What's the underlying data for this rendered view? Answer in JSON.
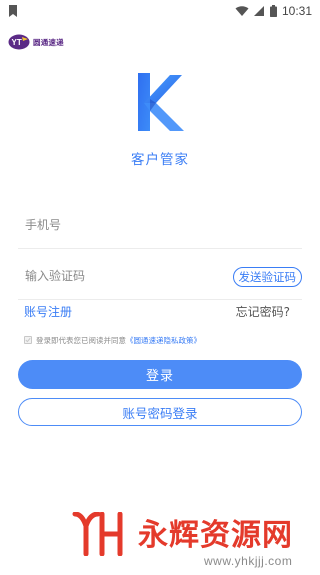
{
  "status_bar": {
    "time": "10:31",
    "icons": [
      "app-notification-icon",
      "wifi-icon",
      "cellular-signal-icon",
      "battery-icon"
    ]
  },
  "brand": {
    "logo_text": "YT",
    "name": "圆通速递"
  },
  "app": {
    "title": "客户管家",
    "logo_letter": "K"
  },
  "form": {
    "phone_placeholder": "手机号",
    "phone_value": "",
    "code_placeholder": "输入验证码",
    "code_value": "",
    "send_code_label": "发送验证码"
  },
  "links": {
    "register": "账号注册",
    "forgot_password": "忘记密码?"
  },
  "agreement": {
    "checked": false,
    "text": "登录即代表您已阅读并同意",
    "policy": "《圆通速递隐私政策》"
  },
  "buttons": {
    "login": "登录",
    "password_login": "账号密码登录"
  },
  "watermark": {
    "name": "永辉资源网",
    "url": "www.yhkjjj.com"
  },
  "colors": {
    "accent": "#3a7df5",
    "button_fill": "#4d8cf7",
    "brand_purple": "#5b2a86",
    "watermark_red": "#e43a2b"
  }
}
